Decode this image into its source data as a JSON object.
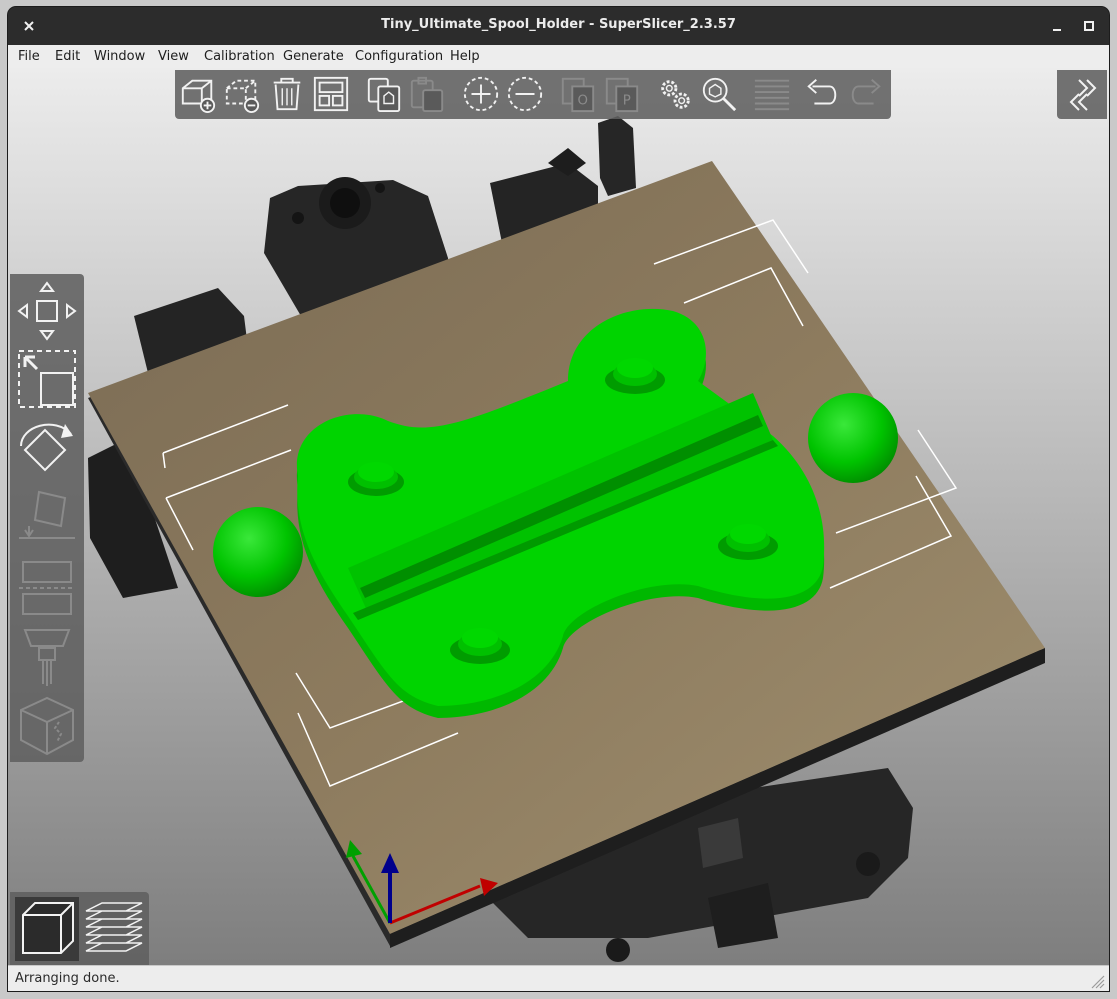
{
  "window": {
    "title": "Tiny_Ultimate_Spool_Holder - SuperSlicer_2.3.57"
  },
  "menu": [
    "File",
    "Edit",
    "Window",
    "View",
    "Calibration",
    "Generate",
    "Configuration",
    "Help"
  ],
  "toolbar": {
    "items": [
      "add-object",
      "delete-object",
      "delete-all",
      "arrange",
      "copy",
      "paste",
      "add-instance",
      "remove-instance",
      "split-to-objects",
      "split-to-parts",
      "settings",
      "search",
      "layers-editing",
      "undo",
      "redo"
    ]
  },
  "left_tools": [
    "move",
    "scale",
    "rotate",
    "place-on-face",
    "cut",
    "paint-supports",
    "seam"
  ],
  "view_modes": [
    "3d-view",
    "preview"
  ],
  "status": {
    "text": "Arranging done."
  },
  "colors": {
    "model": "#00d400",
    "bed": "#8c7a5c",
    "printer": "#2a2a2a",
    "toolbar_bg": "#606060"
  }
}
